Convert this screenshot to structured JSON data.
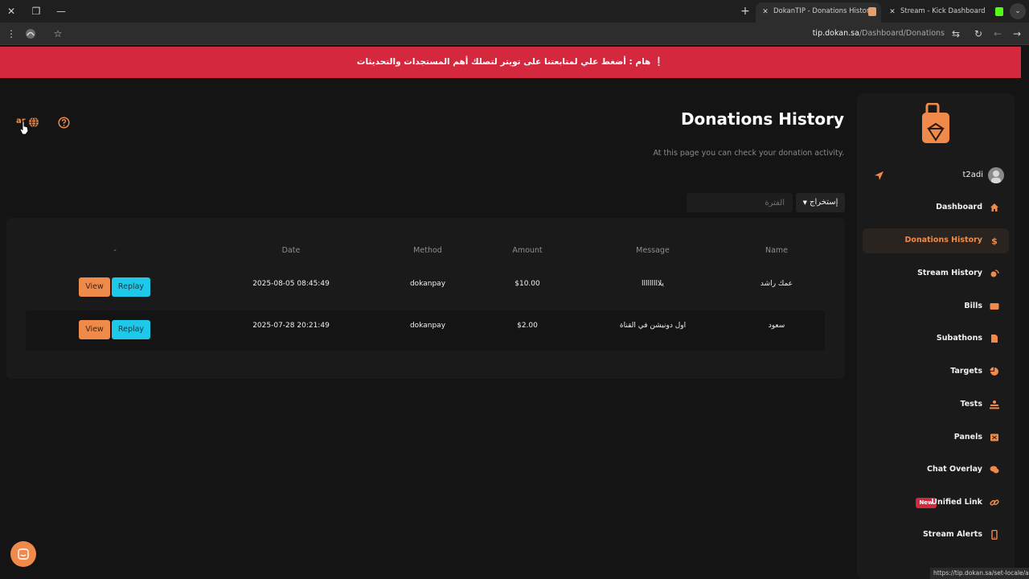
{
  "browser": {
    "tabs": [
      {
        "title": "DokanTIP - Donations History",
        "active": true
      },
      {
        "title": "Stream - Kick Dashboard",
        "active": false
      }
    ],
    "url_host": "tip.dokan.sa",
    "url_path": "/Dashboard/Donations",
    "status_url": "https://tip.dokan.sa/set-locale/ar"
  },
  "banner": {
    "text": "❕ هام : أضغط علي لمتابعتنا على تويتر لتصلك أهم المستجدات والتحديثات"
  },
  "utilities": {
    "lang_label": "ar"
  },
  "header": {
    "title": "Donations History",
    "subtitle": "At this page you can check your donation activity."
  },
  "filters": {
    "export_label": "إستخراج",
    "period_placeholder": "الفترة"
  },
  "table": {
    "columns": {
      "actions": "-",
      "date": "Date",
      "method": "Method",
      "amount": "Amount",
      "message": "Message",
      "name": "Name"
    },
    "rows": [
      {
        "date": "2025-08-05 08:45:49",
        "method": "dokanpay",
        "amount": "$10.00",
        "message": "يلااااااااا",
        "name": "عمك راشد",
        "view": "View",
        "replay": "Replay"
      },
      {
        "date": "2025-07-28 20:21:49",
        "method": "dokanpay",
        "amount": "$2.00",
        "message": "اول دونيشن في القناة",
        "name": "سعود",
        "view": "View",
        "replay": "Replay"
      }
    ]
  },
  "sidebar": {
    "username": "t2adi",
    "new_badge": "New",
    "items": [
      {
        "label": "Dashboard",
        "icon": "home-icon"
      },
      {
        "label": "Donations History",
        "icon": "dollar-icon",
        "active": true
      },
      {
        "label": "Stream History",
        "icon": "satellite-icon"
      },
      {
        "label": "Bills",
        "icon": "bill-icon"
      },
      {
        "label": "Subathons",
        "icon": "file-icon"
      },
      {
        "label": "Targets",
        "icon": "pie-chart-icon"
      },
      {
        "label": "Tests",
        "icon": "test-icon"
      },
      {
        "label": "Panels",
        "icon": "panel-icon"
      },
      {
        "label": "Chat Overlay",
        "icon": "chat-icon"
      },
      {
        "label": "Unified Link",
        "icon": "link-icon"
      },
      {
        "label": "Stream Alerts",
        "icon": "phone-icon"
      }
    ]
  },
  "colors": {
    "accent": "#f08a4b",
    "banner": "#d4283f",
    "replay": "#1ec8e8",
    "background": "#141414"
  }
}
